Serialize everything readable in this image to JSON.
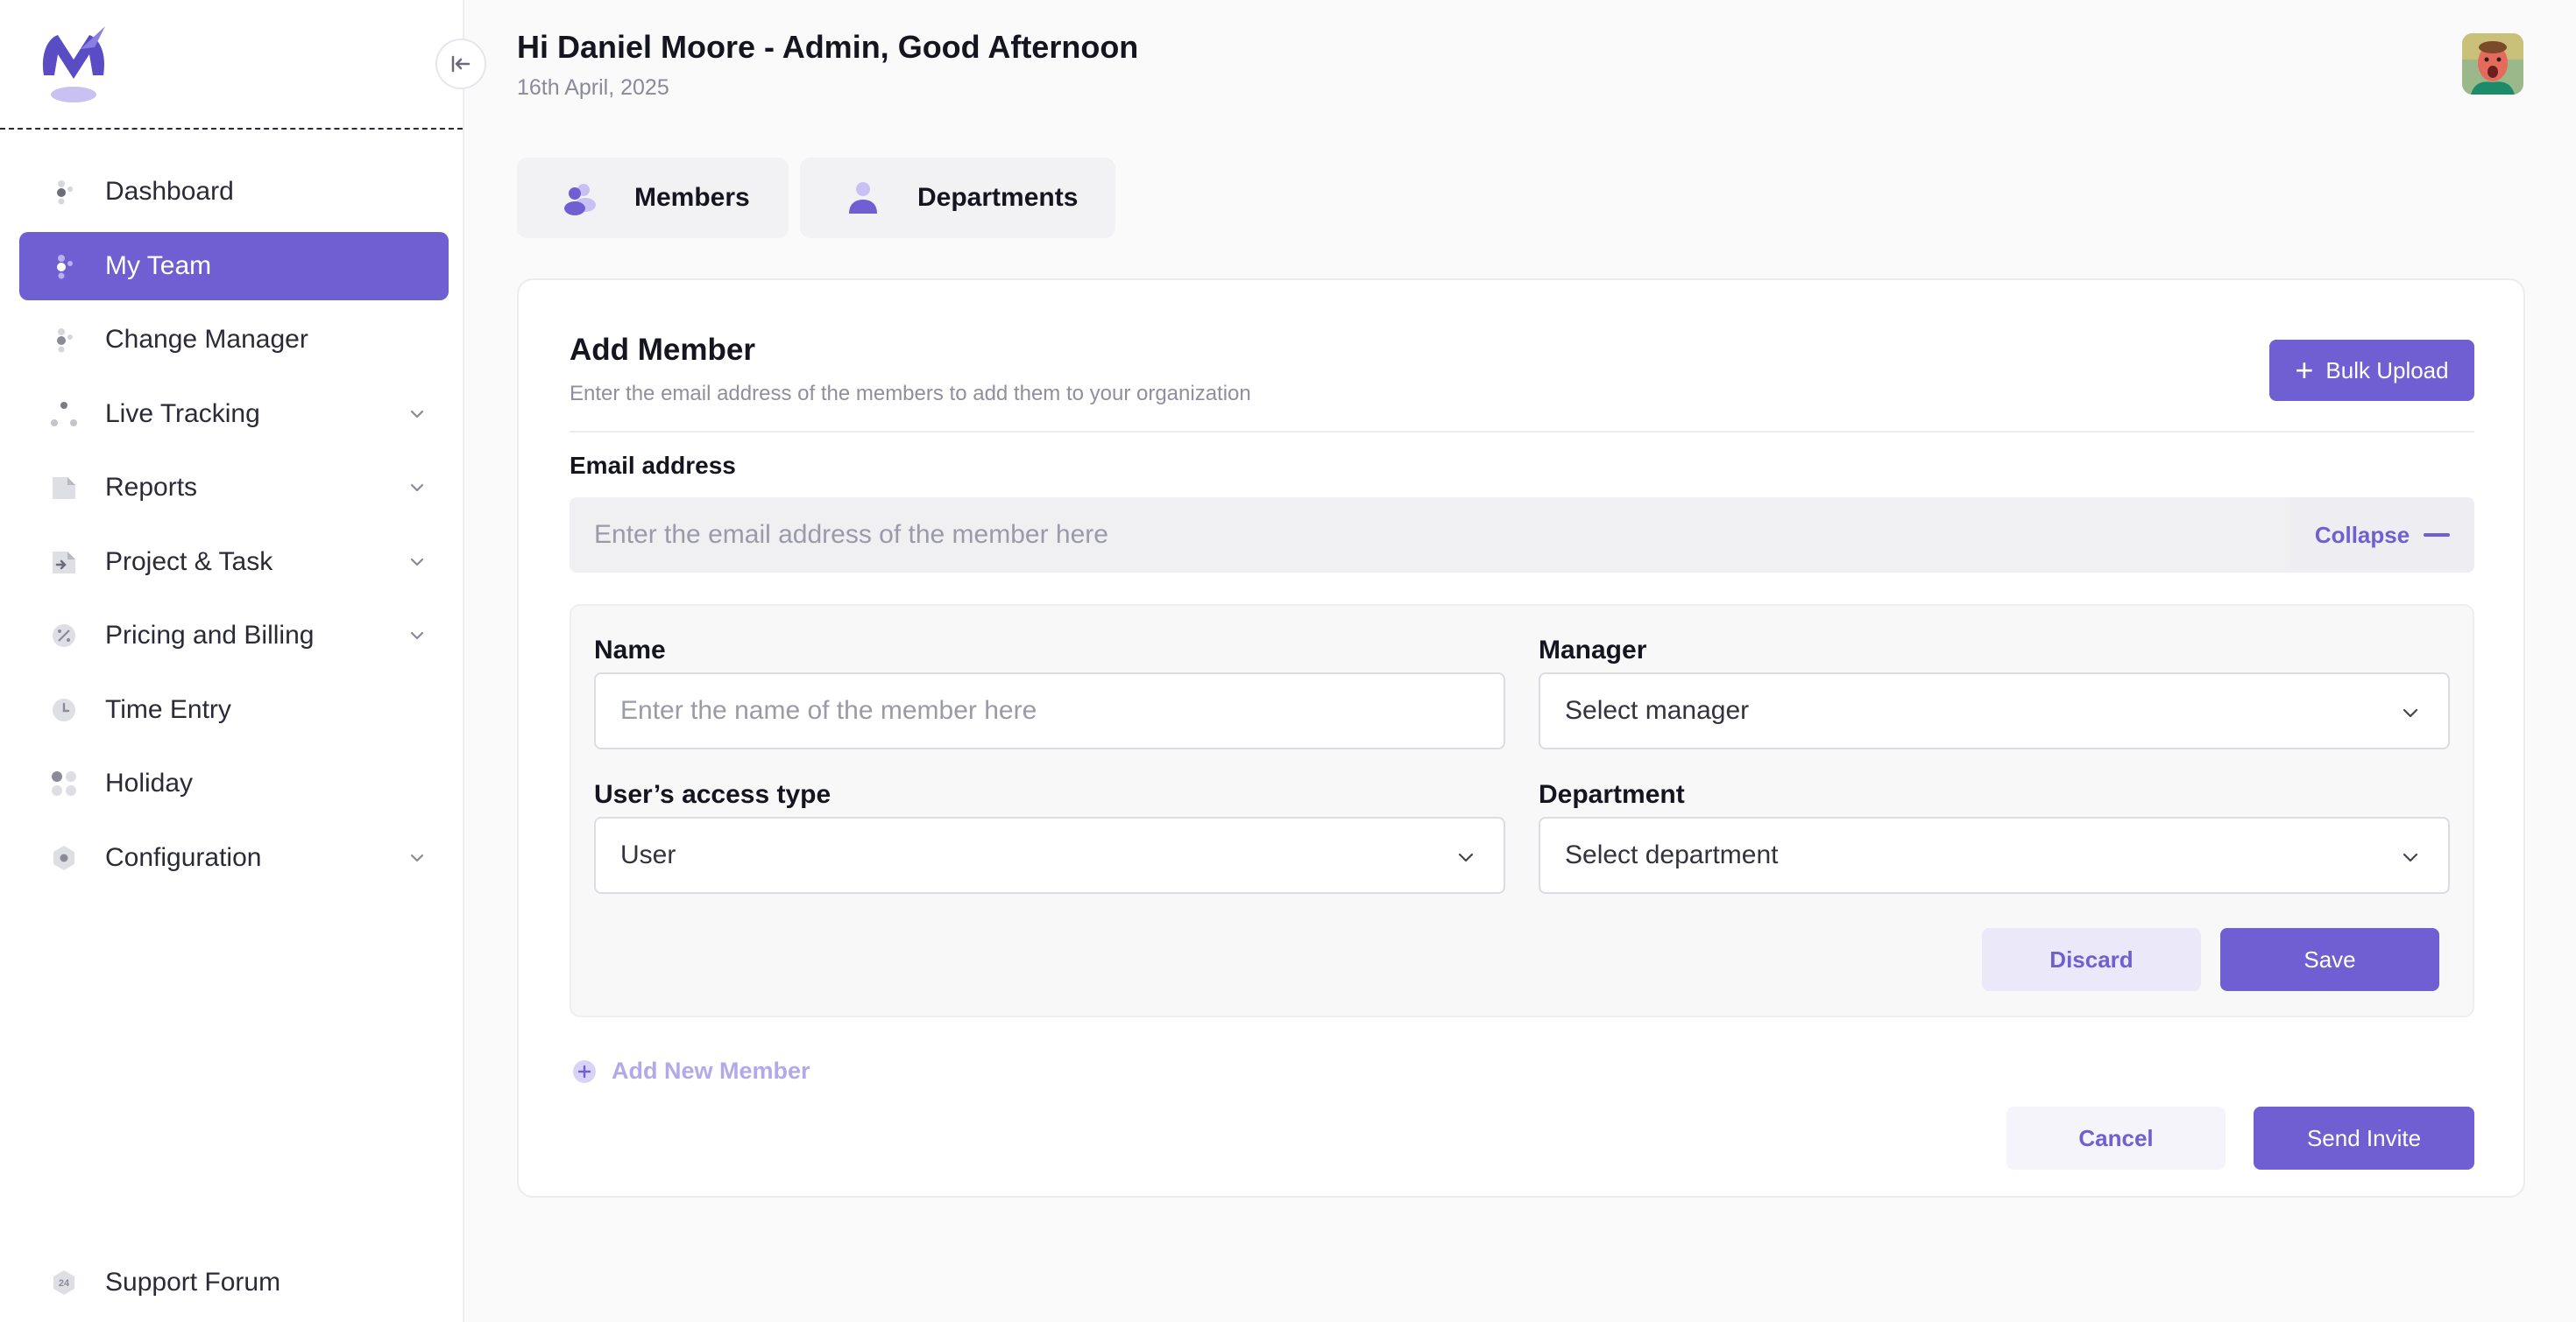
{
  "sidebar": {
    "items": [
      {
        "label": "Dashboard",
        "icon": "dashboard-icon"
      },
      {
        "label": "My Team",
        "icon": "team-icon",
        "active": true
      },
      {
        "label": "Change Manager",
        "icon": "change-manager-icon"
      },
      {
        "label": "Live Tracking",
        "icon": "live-tracking-icon",
        "expandable": true
      },
      {
        "label": "Reports",
        "icon": "reports-icon",
        "expandable": true
      },
      {
        "label": "Project & Task",
        "icon": "project-task-icon",
        "expandable": true
      },
      {
        "label": "Pricing and Billing",
        "icon": "pricing-billing-icon",
        "expandable": true
      },
      {
        "label": "Time Entry",
        "icon": "clock-icon"
      },
      {
        "label": "Holiday",
        "icon": "holiday-icon"
      },
      {
        "label": "Configuration",
        "icon": "configuration-icon",
        "expandable": true
      }
    ],
    "support": {
      "label": "Support Forum",
      "icon": "support-24-icon",
      "badge": "24"
    }
  },
  "header": {
    "greeting": "Hi Daniel Moore - Admin, Good Afternoon",
    "date": "16th April, 2025"
  },
  "tabs": [
    {
      "label": "Members",
      "icon": "members-icon"
    },
    {
      "label": "Departments",
      "icon": "department-icon"
    }
  ],
  "card": {
    "title": "Add Member",
    "subtitle": "Enter the email address of the members to add them to your organization",
    "bulk_upload": "Bulk Upload",
    "email_label": "Email address",
    "email_placeholder": "Enter the email address of the member here",
    "collapse": "Collapse",
    "name_label": "Name",
    "name_placeholder": "Enter the name of the member here",
    "manager_label": "Manager",
    "manager_value": "Select manager",
    "access_label": "User’s access type",
    "access_value": "User",
    "department_label": "Department",
    "department_value": "Select department",
    "discard": "Discard",
    "save": "Save",
    "add_new_member": "Add New Member",
    "cancel": "Cancel",
    "send_invite": "Send Invite"
  },
  "colors": {
    "accent": "#6f5fd2",
    "accent_light": "#ebe8f9",
    "background": "#fafafa"
  }
}
